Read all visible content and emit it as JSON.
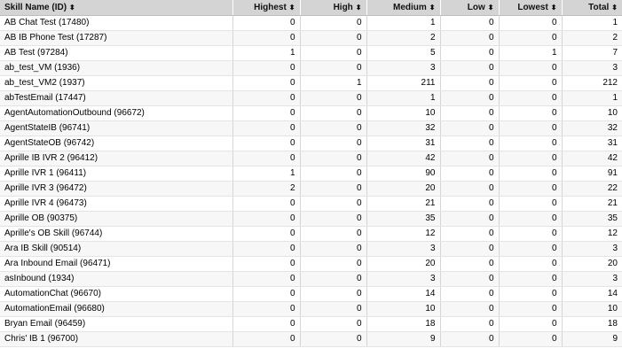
{
  "columns": [
    {
      "label": "Skill Name (ID)",
      "sort_icon": "sort-arrows-icon"
    },
    {
      "label": "Highest",
      "sort_icon": "sort-arrows-icon"
    },
    {
      "label": "High",
      "sort_icon": "sort-arrows-icon"
    },
    {
      "label": "Medium",
      "sort_icon": "sort-arrows-icon"
    },
    {
      "label": "Low",
      "sort_icon": "sort-arrows-icon"
    },
    {
      "label": "Lowest",
      "sort_icon": "sort-arrows-icon"
    },
    {
      "label": "Total",
      "sort_icon": "sort-arrows-icon"
    }
  ],
  "rows": [
    [
      "AB Chat Test (17480)",
      "0",
      "0",
      "1",
      "0",
      "0",
      "1"
    ],
    [
      "AB IB Phone Test (17287)",
      "0",
      "0",
      "2",
      "0",
      "0",
      "2"
    ],
    [
      "AB Test (97284)",
      "1",
      "0",
      "5",
      "0",
      "1",
      "7"
    ],
    [
      "ab_test_VM (1936)",
      "0",
      "0",
      "3",
      "0",
      "0",
      "3"
    ],
    [
      "ab_test_VM2 (1937)",
      "0",
      "1",
      "211",
      "0",
      "0",
      "212"
    ],
    [
      "abTestEmail (17447)",
      "0",
      "0",
      "1",
      "0",
      "0",
      "1"
    ],
    [
      "AgentAutomationOutbound (96672)",
      "0",
      "0",
      "10",
      "0",
      "0",
      "10"
    ],
    [
      "AgentStateIB (96741)",
      "0",
      "0",
      "32",
      "0",
      "0",
      "32"
    ],
    [
      "AgentStateOB (96742)",
      "0",
      "0",
      "31",
      "0",
      "0",
      "31"
    ],
    [
      "Aprille IB IVR 2 (96412)",
      "0",
      "0",
      "42",
      "0",
      "0",
      "42"
    ],
    [
      "Aprille IVR 1 (96411)",
      "1",
      "0",
      "90",
      "0",
      "0",
      "91"
    ],
    [
      "Aprille IVR 3 (96472)",
      "2",
      "0",
      "20",
      "0",
      "0",
      "22"
    ],
    [
      "Aprille IVR 4 (96473)",
      "0",
      "0",
      "21",
      "0",
      "0",
      "21"
    ],
    [
      "Aprille OB (90375)",
      "0",
      "0",
      "35",
      "0",
      "0",
      "35"
    ],
    [
      "Aprille's OB Skill (96744)",
      "0",
      "0",
      "12",
      "0",
      "0",
      "12"
    ],
    [
      "Ara IB Skill (90514)",
      "0",
      "0",
      "3",
      "0",
      "0",
      "3"
    ],
    [
      "Ara Inbound Email (96471)",
      "0",
      "0",
      "20",
      "0",
      "0",
      "20"
    ],
    [
      "asInbound (1934)",
      "0",
      "0",
      "3",
      "0",
      "0",
      "3"
    ],
    [
      "AutomationChat (96670)",
      "0",
      "0",
      "14",
      "0",
      "0",
      "14"
    ],
    [
      "AutomationEmail (96680)",
      "0",
      "0",
      "10",
      "0",
      "0",
      "10"
    ],
    [
      "Bryan Email (96459)",
      "0",
      "0",
      "18",
      "0",
      "0",
      "18"
    ],
    [
      "Chris' IB 1 (96700)",
      "0",
      "0",
      "9",
      "0",
      "0",
      "9"
    ]
  ]
}
